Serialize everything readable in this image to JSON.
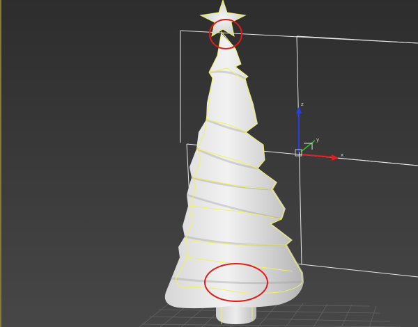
{
  "viewport": {
    "background_top": "#2d2d2d",
    "background_bottom": "#474747",
    "bounding_box_color": "#e8e8e8",
    "selection_outline_color": "#f2f25a",
    "annotation_color": "#e11b1b",
    "grid_color": "#6a6a6a"
  },
  "gizmo": {
    "x_label": "x",
    "y_label": "y",
    "z_label": "z",
    "x_color": "#e02020",
    "y_color": "#2fbf2f",
    "z_color": "#2a3fe0",
    "center_color": "#cccccc"
  },
  "model": {
    "surface_light": "#eeeeee",
    "surface_mid": "#cfcfcf",
    "surface_dark": "#a9a9a9"
  },
  "annotations": [
    {
      "name": "top-annotation-circle"
    },
    {
      "name": "base-annotation-circle"
    }
  ]
}
